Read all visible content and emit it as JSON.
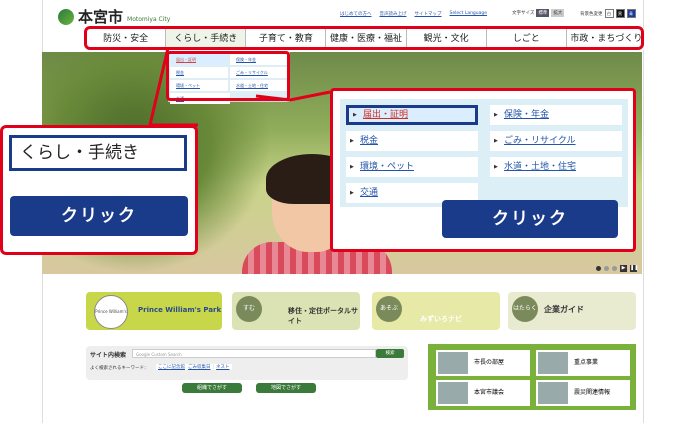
{
  "header": {
    "site_name": "本宮市",
    "site_name_roman": "Motomiya City",
    "top_links": [
      "はじめての方へ",
      "音声読み上げ",
      "サイトマップ",
      "Select Language"
    ],
    "font_size_label": "文字サイズ",
    "font_size_buttons": [
      "標準",
      "拡大"
    ],
    "color_label": "背景色変更",
    "color_options": [
      "白",
      "黒",
      "青"
    ]
  },
  "nav": {
    "items": [
      "防災・安全",
      "くらし・手続き",
      "子育て・教育",
      "健康・医療・福祉",
      "観光・文化",
      "しごと",
      "市政・まちづくり"
    ],
    "active_index": 1
  },
  "dropdown_small": {
    "items": [
      "届出・証明",
      "保険・年金",
      "税金",
      "ごみ・リサイクル",
      "環境・ペット",
      "水道・土地・住宅",
      "交通"
    ]
  },
  "dropdown_big": {
    "items": [
      "届出・証明",
      "保険・年金",
      "税金",
      "ごみ・リサイクル",
      "環境・ペット",
      "水道・土地・住宅",
      "交通"
    ],
    "highlighted_index": 0
  },
  "callout_left": {
    "label": "くらし・手続き",
    "click": "クリック"
  },
  "callout_right": {
    "click": "クリック"
  },
  "hero": {
    "next_arrow": "❯",
    "pager_buttons": [
      "▶",
      "❚❚"
    ]
  },
  "banners": [
    {
      "badge": "Prince William's Park",
      "text": "Prince William's Park"
    },
    {
      "badge": "すむ",
      "text": "移住・定住ポータルサイト"
    },
    {
      "badge": "あそぶ",
      "text": "みずいろナビ"
    },
    {
      "badge": "はたらく",
      "text": "企業ガイド"
    }
  ],
  "search": {
    "label": "サイト内検索",
    "placeholder": "Google Custom Search",
    "button": "検索",
    "keywords_label": "よく検索されるキーワード：",
    "keywords": [
      "ここに記念館",
      "ごみ収集日",
      "ネスト"
    ],
    "org_button": "組織でさがす",
    "map_button": "地図でさがす"
  },
  "tiles": [
    "市長の部屋",
    "重点事業",
    "本宮市議会",
    "震災関連情報"
  ]
}
